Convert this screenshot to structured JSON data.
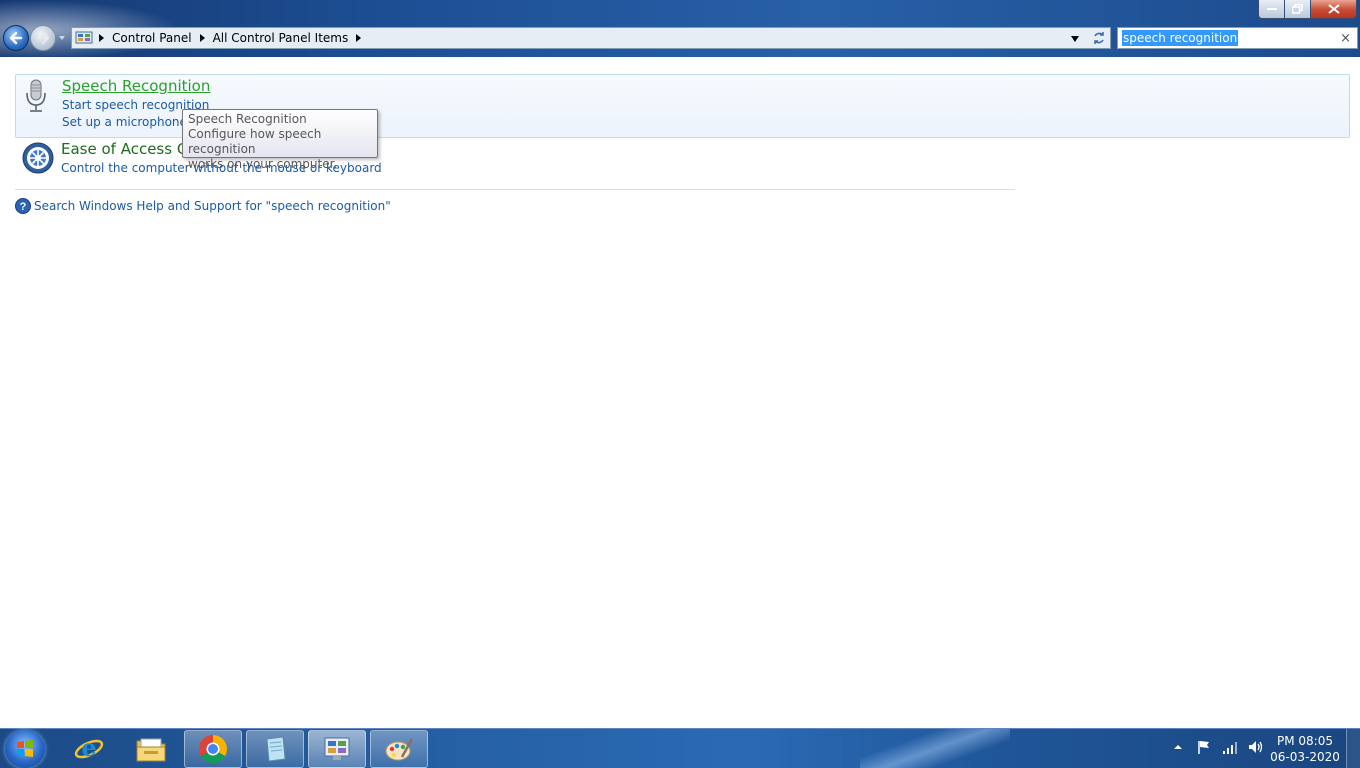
{
  "address_bar": {
    "breadcrumbs": [
      "Control Panel",
      "All Control Panel Items"
    ]
  },
  "search": {
    "value": "speech recognition",
    "clear_glyph": "×"
  },
  "results": [
    {
      "title": "Speech Recognition",
      "icon": "microphone-icon",
      "links": [
        "Start speech recognition",
        "Set up a microphone"
      ]
    },
    {
      "title": "Ease of Access Ce",
      "icon": "ease-of-access-icon",
      "links": [
        "Control the computer without the mouse or keyboard"
      ]
    }
  ],
  "help": {
    "text": "Search Windows Help and Support for \"speech recognition\""
  },
  "tooltip": {
    "title": "Speech Recognition",
    "line1": "Configure how speech recognition",
    "line2": "works on your computer."
  },
  "taskbar": {
    "pinned": [
      "internet-explorer-icon",
      "file-explorer-icon",
      "chrome-icon",
      "notepad-icon",
      "control-panel-icon",
      "paint-icon"
    ],
    "clock": {
      "time": "PM 08:05",
      "date": "06-03-2020"
    }
  },
  "colors": {
    "link": "#1a5aa8",
    "hover_title": "#2aa12a",
    "title": "#1e6b1e",
    "selection": "#3399ff"
  }
}
